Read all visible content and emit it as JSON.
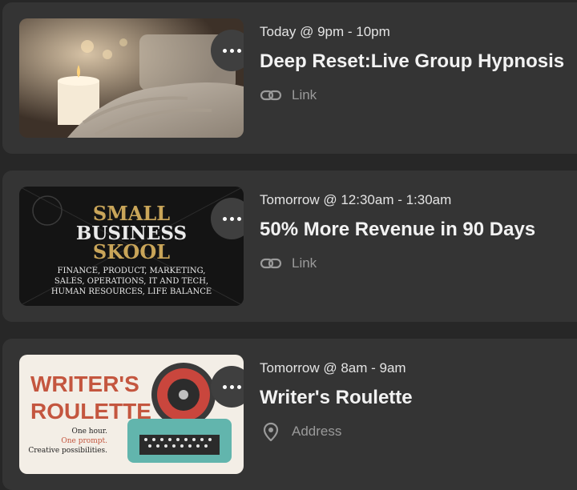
{
  "events": [
    {
      "time": "Today @ 9pm - 10pm",
      "title": "Deep Reset:Live Group Hypnosis",
      "meta_icon": "link-icon",
      "meta_label": "Link"
    },
    {
      "time": "Tomorrow @ 12:30am - 1:30am",
      "title": "50% More Revenue in 90 Days",
      "meta_icon": "link-icon",
      "meta_label": "Link",
      "thumb_text": {
        "line1": "SMALL",
        "line2": "BUSINESS",
        "line3": "SKOOL",
        "sub1": "FINANCE, PRODUCT, MARKETING,",
        "sub2": "SALES, OPERATIONS, IT AND TECH,",
        "sub3": "HUMAN RESOURCES, LIFE BALANCE"
      }
    },
    {
      "time": "Tomorrow @ 8am - 9am",
      "title": "Writer's Roulette",
      "meta_icon": "location-pin-icon",
      "meta_label": "Address",
      "thumb_text": {
        "line1": "WRITER'S",
        "line2": "ROULETTE",
        "sub1": "One hour.",
        "sub2": "One prompt.",
        "sub3": "Creative possibilities."
      }
    }
  ],
  "colors": {
    "background": "#272727",
    "card": "#343434",
    "more_button": "#3f3f3f",
    "muted_text": "#9a9a9a"
  }
}
